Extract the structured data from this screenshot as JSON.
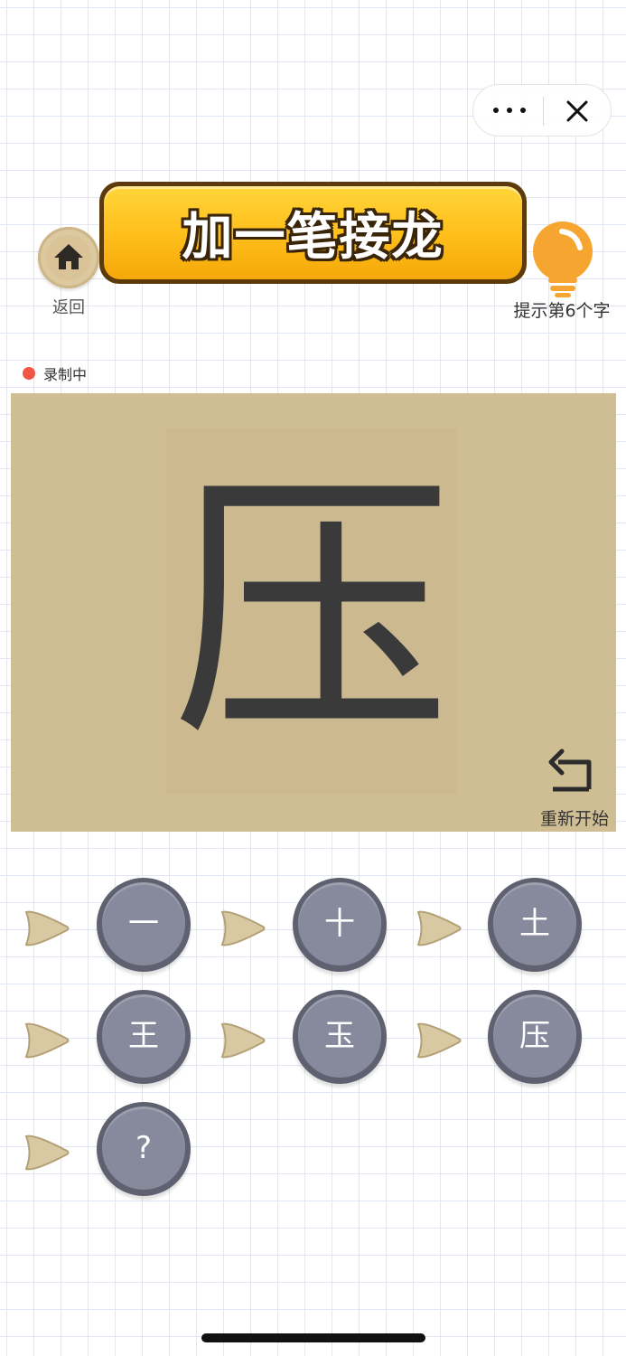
{
  "header": {
    "title": "加一笔接龙",
    "back_label": "返回",
    "hint_label": "提示第6个字",
    "menu_icon": "more-dots-icon",
    "close_icon": "close-icon"
  },
  "recording": {
    "label": "录制中",
    "color": "#f05545"
  },
  "board": {
    "current_char": "压",
    "restart_label": "重新开始",
    "background": "#cfbd93"
  },
  "chain": [
    {
      "char": "一"
    },
    {
      "char": "十"
    },
    {
      "char": "土"
    },
    {
      "char": "王"
    },
    {
      "char": "玉"
    },
    {
      "char": "压"
    },
    {
      "char": "?"
    }
  ],
  "colors": {
    "banner": "#ffc21f",
    "bubble": "#878a9c",
    "hint_bulb": "#f7a531"
  }
}
